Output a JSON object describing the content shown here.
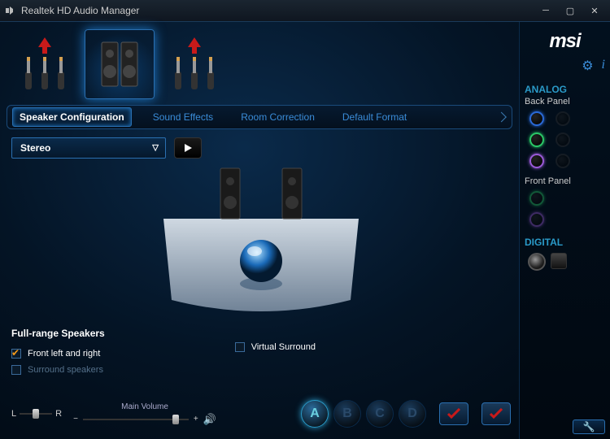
{
  "window": {
    "title": "Realtek HD Audio Manager"
  },
  "brand": "msi",
  "tabs": [
    {
      "label": "Speaker Configuration",
      "active": true
    },
    {
      "label": "Sound Effects"
    },
    {
      "label": "Room Correction"
    },
    {
      "label": "Default Format"
    }
  ],
  "dropdown": {
    "selected": "Stereo"
  },
  "options_title": "Full-range Speakers",
  "options": {
    "front": {
      "label": "Front left and right",
      "checked": true,
      "enabled": true
    },
    "surround": {
      "label": "Surround speakers",
      "checked": false,
      "enabled": false
    },
    "virtual": {
      "label": "Virtual Surround",
      "checked": false,
      "enabled": true
    }
  },
  "balance": {
    "left": "L",
    "right": "R"
  },
  "volume": {
    "label": "Main Volume",
    "minus": "−",
    "plus": "+"
  },
  "letters": [
    "A",
    "B",
    "C",
    "D"
  ],
  "side": {
    "analog": "ANALOG",
    "back": "Back Panel",
    "front": "Front Panel",
    "digital": "DIGITAL"
  }
}
